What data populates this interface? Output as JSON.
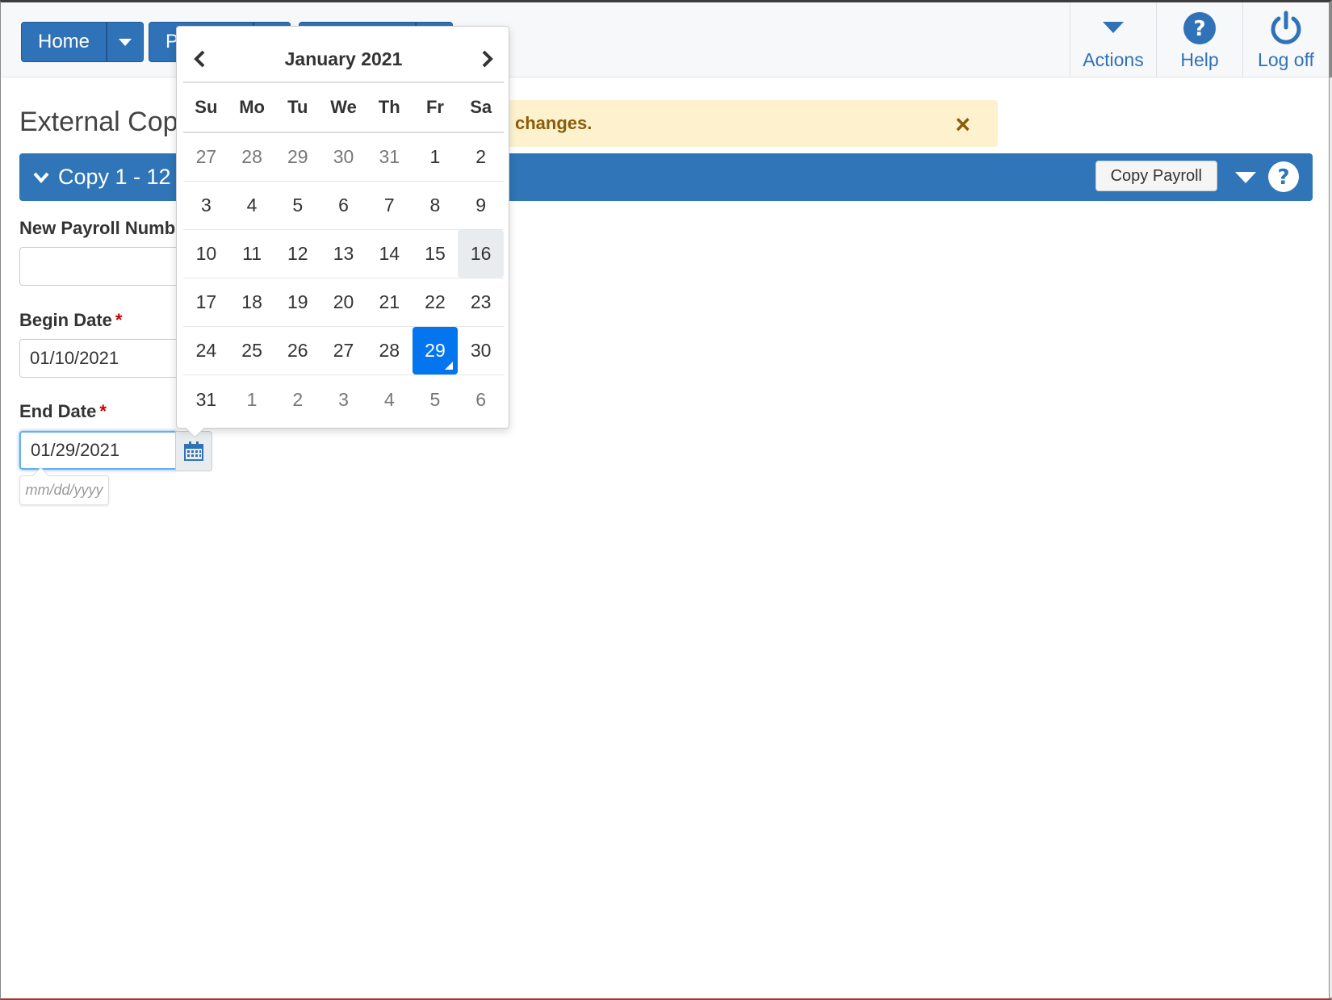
{
  "nav": {
    "home_label": "Home",
    "second_label": "P",
    "actions_label": "Actions",
    "help_label": "Help",
    "logoff_label": "Log off"
  },
  "page": {
    "title": "External Cop",
    "alert_text": "changes.",
    "alert_close": "×"
  },
  "panel": {
    "title": "Copy 1 - 12",
    "copy_button": "Copy Payroll"
  },
  "form": {
    "payroll_label": "New Payroll Numb",
    "payroll_value": "",
    "begin_label": "Begin Date",
    "begin_value": "01/10/2021",
    "end_label": "End Date",
    "end_value": "01/29/2021",
    "required_mark": "*",
    "date_hint": "mm/dd/yyyy"
  },
  "datepicker": {
    "month_label": "January 2021",
    "days_of_week": [
      "Su",
      "Mo",
      "Tu",
      "We",
      "Th",
      "Fr",
      "Sa"
    ],
    "weeks": [
      [
        "27",
        "28",
        "29",
        "30",
        "31",
        "1",
        "2"
      ],
      [
        "3",
        "4",
        "5",
        "6",
        "7",
        "8",
        "9"
      ],
      [
        "10",
        "11",
        "12",
        "13",
        "14",
        "15",
        "16"
      ],
      [
        "17",
        "18",
        "19",
        "20",
        "21",
        "22",
        "23"
      ],
      [
        "24",
        "25",
        "26",
        "27",
        "28",
        "29",
        "30"
      ],
      [
        "31",
        "1",
        "2",
        "3",
        "4",
        "5",
        "6"
      ]
    ],
    "today": "16",
    "selected": "29"
  },
  "colors": {
    "primary": "#2f72b8",
    "selected_day": "#0275ef",
    "alert_bg": "#fdf2cd",
    "alert_text": "#8a5d0a"
  }
}
